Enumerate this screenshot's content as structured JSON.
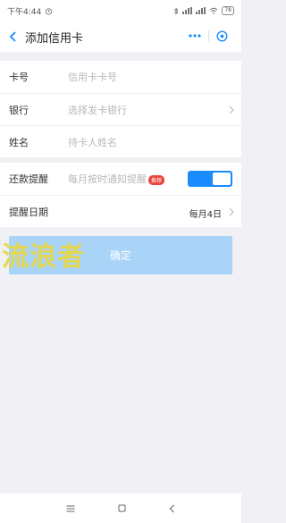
{
  "status_bar": {
    "time": "下午4:44",
    "battery": "78"
  },
  "nav": {
    "title": "添加信用卡"
  },
  "form": {
    "card_number": {
      "label": "卡号",
      "placeholder": "信用卡卡号"
    },
    "bank": {
      "label": "银行",
      "placeholder": "选择发卡银行"
    },
    "name": {
      "label": "姓名",
      "placeholder": "持卡人姓名"
    }
  },
  "reminder": {
    "label": "还款提醒",
    "hint": "每月按时通知提醒",
    "badge": "推荐",
    "enabled": true
  },
  "date": {
    "label": "提醒日期",
    "value": "每月4日"
  },
  "confirm_label": "确定",
  "watermark": "流浪者",
  "colors": {
    "accent": "#1a8cff",
    "button_disabled": "#a9d3f7",
    "badge": "#e8473e",
    "background": "#f0f0f5"
  }
}
